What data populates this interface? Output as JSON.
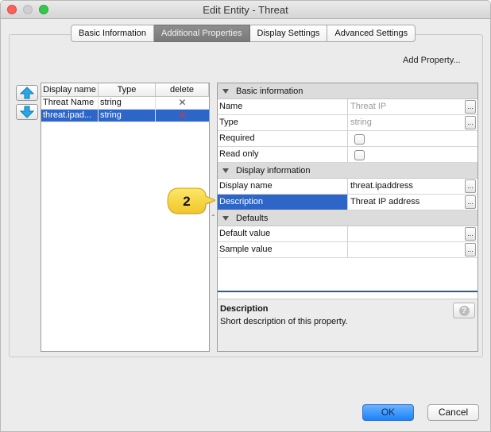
{
  "window": {
    "title": "Edit Entity - Threat"
  },
  "tabs": [
    {
      "label": "Basic Information",
      "active": false
    },
    {
      "label": "Additional Properties",
      "active": true
    },
    {
      "label": "Display Settings",
      "active": false
    },
    {
      "label": "Advanced Settings",
      "active": false
    }
  ],
  "add_property_label": "Add Property...",
  "property_list": {
    "headers": [
      "Display name",
      "Type",
      "delete"
    ],
    "rows": [
      {
        "display_name": "Threat Name",
        "type": "string",
        "delete_icon": "close-icon",
        "selected": false
      },
      {
        "display_name": "threat.ipad...",
        "type": "string",
        "delete_icon": "close-icon",
        "selected": true
      }
    ]
  },
  "sheet": {
    "sections": {
      "basic": "Basic information",
      "display": "Display information",
      "defaults": "Defaults"
    },
    "basic_rows": [
      {
        "name": "Name",
        "value": "Threat IP"
      },
      {
        "name": "Type",
        "value": "string"
      },
      {
        "name": "Required",
        "value": ""
      },
      {
        "name": "Read only",
        "value": ""
      }
    ],
    "display_rows": [
      {
        "name": "Display name",
        "value": "threat.ipaddress"
      },
      {
        "name": "Description",
        "value": "Threat IP address"
      }
    ],
    "defaults_rows": [
      {
        "name": "Default value",
        "value": ""
      },
      {
        "name": "Sample value",
        "value": ""
      }
    ],
    "ellipsis_label": "...",
    "required_checked": false,
    "read_only_checked": false
  },
  "description_panel": {
    "title": "Description",
    "text": "Short description of this property.",
    "help_icon": "help-icon"
  },
  "callout": {
    "number": "2",
    "accent": "#f7d83a"
  },
  "buttons": {
    "ok": "OK",
    "cancel": "Cancel"
  },
  "colors": {
    "selection": "#2e66c8",
    "active_tab": "#7f7f7f",
    "ok_button": "#1a82fb",
    "delete_red": "#d43a2a"
  }
}
